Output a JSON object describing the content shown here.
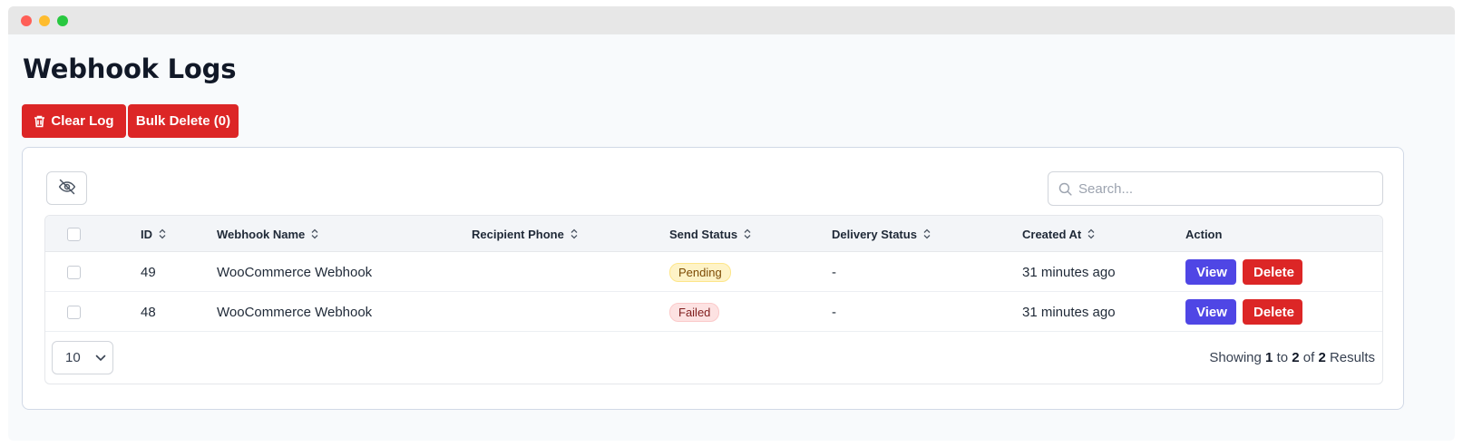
{
  "page": {
    "title": "Webhook Logs"
  },
  "actions": {
    "clear_log": "Clear Log",
    "bulk_delete": "Bulk Delete (0)"
  },
  "search": {
    "placeholder": "Search..."
  },
  "table": {
    "columns": [
      "ID",
      "Webhook Name",
      "Recipient Phone",
      "Send Status",
      "Delivery Status",
      "Created At",
      "Action"
    ],
    "rows": [
      {
        "id": "49",
        "webhook_name": "WooCommerce Webhook",
        "recipient_phone": "",
        "send_status": "Pending",
        "delivery_status": "-",
        "created_at": "31 minutes ago"
      },
      {
        "id": "48",
        "webhook_name": "WooCommerce Webhook",
        "recipient_phone": "",
        "send_status": "Failed",
        "delivery_status": "-",
        "created_at": "31 minutes ago"
      }
    ],
    "row_actions": {
      "view": "View",
      "delete": "Delete"
    }
  },
  "pagination": {
    "page_size": "10",
    "showing_prefix": "Showing",
    "from": "1",
    "to_word": "to",
    "to": "2",
    "of_word": "of",
    "total": "2",
    "suffix": "Results"
  },
  "colors": {
    "danger": "#dc2626",
    "primary": "#4f46e5",
    "pending_bg": "#fef3c7",
    "failed_bg": "#fde2e2"
  },
  "icons": {
    "clear_log": "trash-icon",
    "column_toggle": "eye-off-icon",
    "search": "search-icon",
    "sort": "sort-icon",
    "page_size": "chevron-down-icon"
  }
}
